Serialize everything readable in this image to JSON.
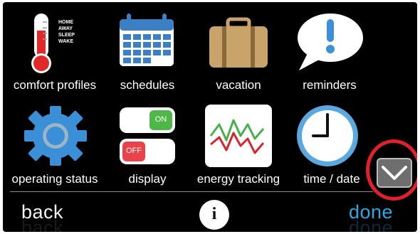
{
  "menu": {
    "items": [
      {
        "label": "comfort profiles",
        "icon": "thermometer-icon",
        "sub_labels": [
          "HOME",
          "AWAY",
          "SLEEP",
          "WAKE"
        ]
      },
      {
        "label": "schedules",
        "icon": "calendar-icon"
      },
      {
        "label": "vacation",
        "icon": "suitcase-icon"
      },
      {
        "label": "reminders",
        "icon": "speech-bubble-exclamation-icon"
      },
      {
        "label": "operating status",
        "icon": "gear-icon"
      },
      {
        "label": "display",
        "icon": "toggle-switches-icon",
        "on_label": "ON",
        "off_label": "OFF"
      },
      {
        "label": "energy tracking",
        "icon": "line-graph-icon"
      },
      {
        "label": "time / date",
        "icon": "clock-icon"
      }
    ]
  },
  "footer": {
    "back_label": "back",
    "info_label": "i",
    "done_label": "done"
  },
  "scroll": {
    "down_icon": "chevron-down-icon"
  },
  "colors": {
    "background": "#000000",
    "accent_blue": "#2aa9e0",
    "highlight_red": "#e0202a",
    "toggle_on": "#4db848",
    "toggle_off": "#e8424a"
  }
}
